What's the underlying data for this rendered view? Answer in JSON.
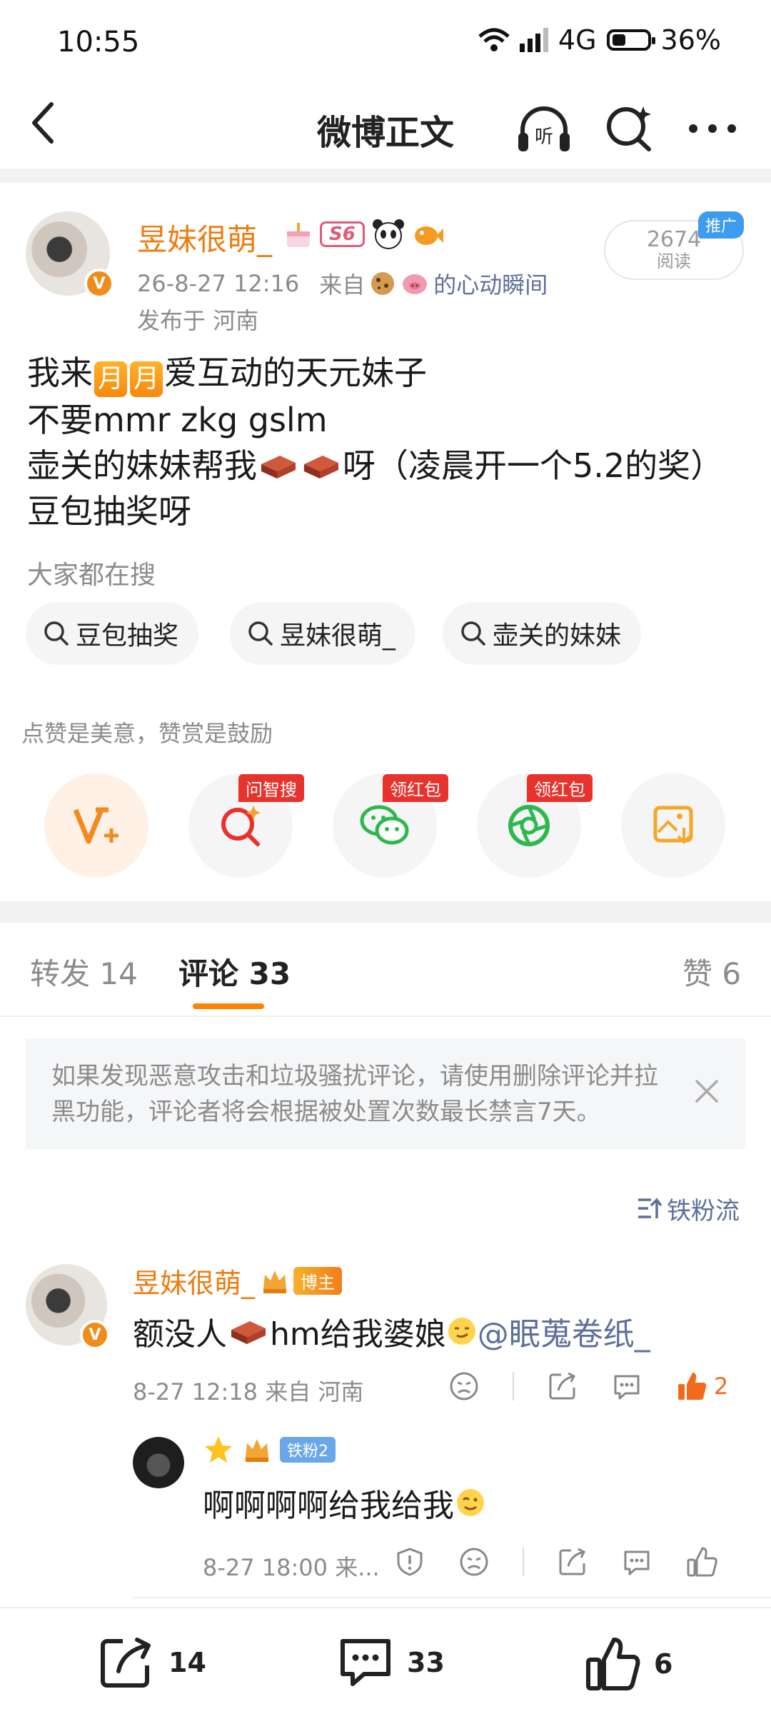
{
  "status_bar": {
    "time": "10:55",
    "network": "4G",
    "battery": "36%"
  },
  "header": {
    "title": "微博正文",
    "listen_label": "听"
  },
  "post": {
    "author": "昱妹很萌_",
    "vip_badge": "S6",
    "date": "26-8-27 12:16",
    "source_prefix": "来自",
    "source_name": "的心动瞬间",
    "location": "发布于 河南",
    "reads": "2674",
    "reads_label": "阅读",
    "promo_tag": "推广",
    "line1_a": "我来",
    "moon_char": "月",
    "line1_b": "爱互动的天元妹子",
    "line2": "不要mmr zkg gslm",
    "line3_a": "壶关的妹妹帮我",
    "line3_b": "呀（凌晨开一个5.2的奖）",
    "line4": "豆包抽奖呀"
  },
  "search": {
    "title": "大家都在搜",
    "chips": [
      "豆包抽奖",
      "昱妹很萌_",
      "壶关的妹妹"
    ]
  },
  "encourage": {
    "text": "点赞是美意，赞赏是鼓励",
    "tags": [
      "问智搜",
      "领红包",
      "领红包"
    ]
  },
  "tabs": {
    "repost": "转发 14",
    "comments": "评论 33",
    "likes": "赞 6"
  },
  "notice": {
    "text": "如果发现恶意攻击和垃圾骚扰评论，请使用删除评论并拉黑功能，评论者将会根据被处置次数最长禁言7天。"
  },
  "sort": {
    "label": "铁粉流"
  },
  "comments": [
    {
      "author": "昱妹很萌_",
      "badge": "博主",
      "text_a": "额没人",
      "text_b": "hm给我婆娘",
      "mention": "@眠蒐卷纸_",
      "meta": "8-27 12:18  来自 河南",
      "likes": "2"
    },
    {
      "badge": "铁粉2",
      "text": "啊啊啊啊给我给我",
      "meta": "8-27 18:00  来..."
    }
  ],
  "bottom": {
    "repost": "14",
    "comments": "33",
    "likes": "6"
  },
  "colors": {
    "accent": "#ff8200",
    "username": "#ee7c10",
    "link": "#5d6f9b",
    "tag_red": "#e8332c"
  }
}
